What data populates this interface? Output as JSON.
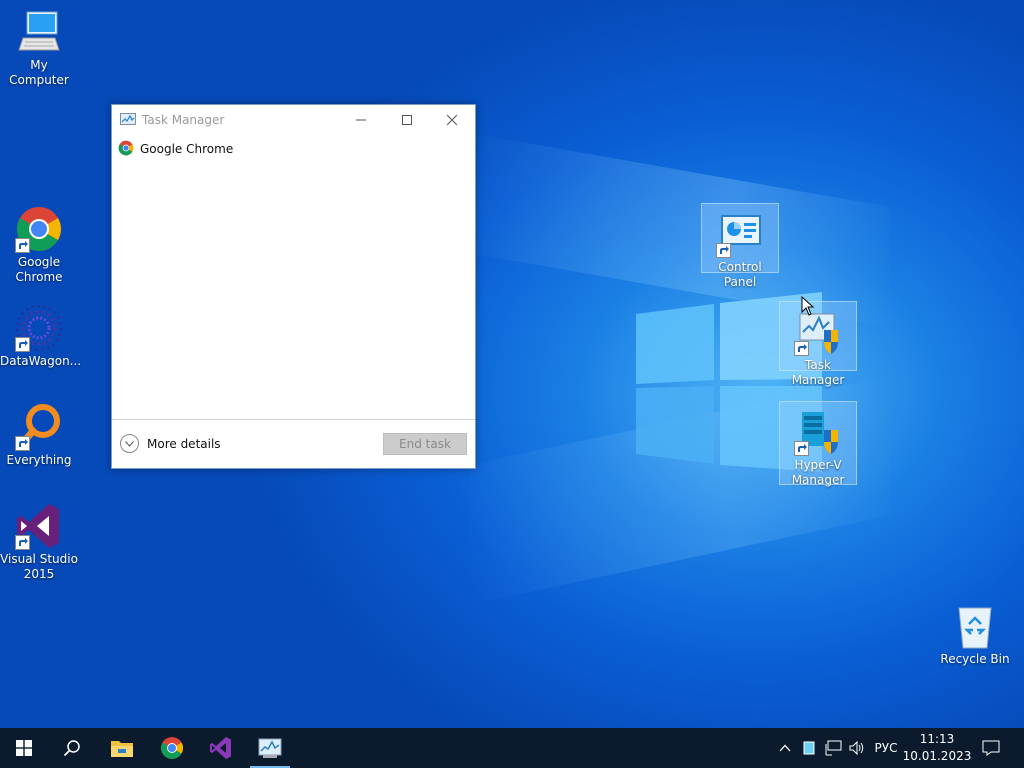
{
  "desktop": {
    "icons": [
      {
        "label": "My Computer"
      },
      {
        "label": "Google Chrome"
      },
      {
        "label": "DataWagon..."
      },
      {
        "label": "Everything"
      },
      {
        "label": "Visual Studio 2015"
      },
      {
        "label": "Control Panel"
      },
      {
        "label": "Task Manager"
      },
      {
        "label": "Hyper-V Manager"
      },
      {
        "label": "Recycle Bin"
      }
    ]
  },
  "task_manager": {
    "title": "Task Manager",
    "apps": [
      {
        "name": "Google Chrome",
        "icon": "chrome-icon"
      }
    ],
    "more_details_label": "More details",
    "end_task_label": "End task"
  },
  "taskbar": {
    "pinned": [
      {
        "icon": "file-explorer-icon"
      },
      {
        "icon": "chrome-icon"
      },
      {
        "icon": "visual-studio-icon"
      },
      {
        "icon": "task-manager-icon",
        "active": true
      }
    ],
    "language": "РУС",
    "time": "11:13",
    "date": "10.01.2023"
  },
  "colors": {
    "desktop_blue": "#0a5ed4",
    "taskbar_bg": "#0b1a2c",
    "accent": "#76b9ed"
  }
}
